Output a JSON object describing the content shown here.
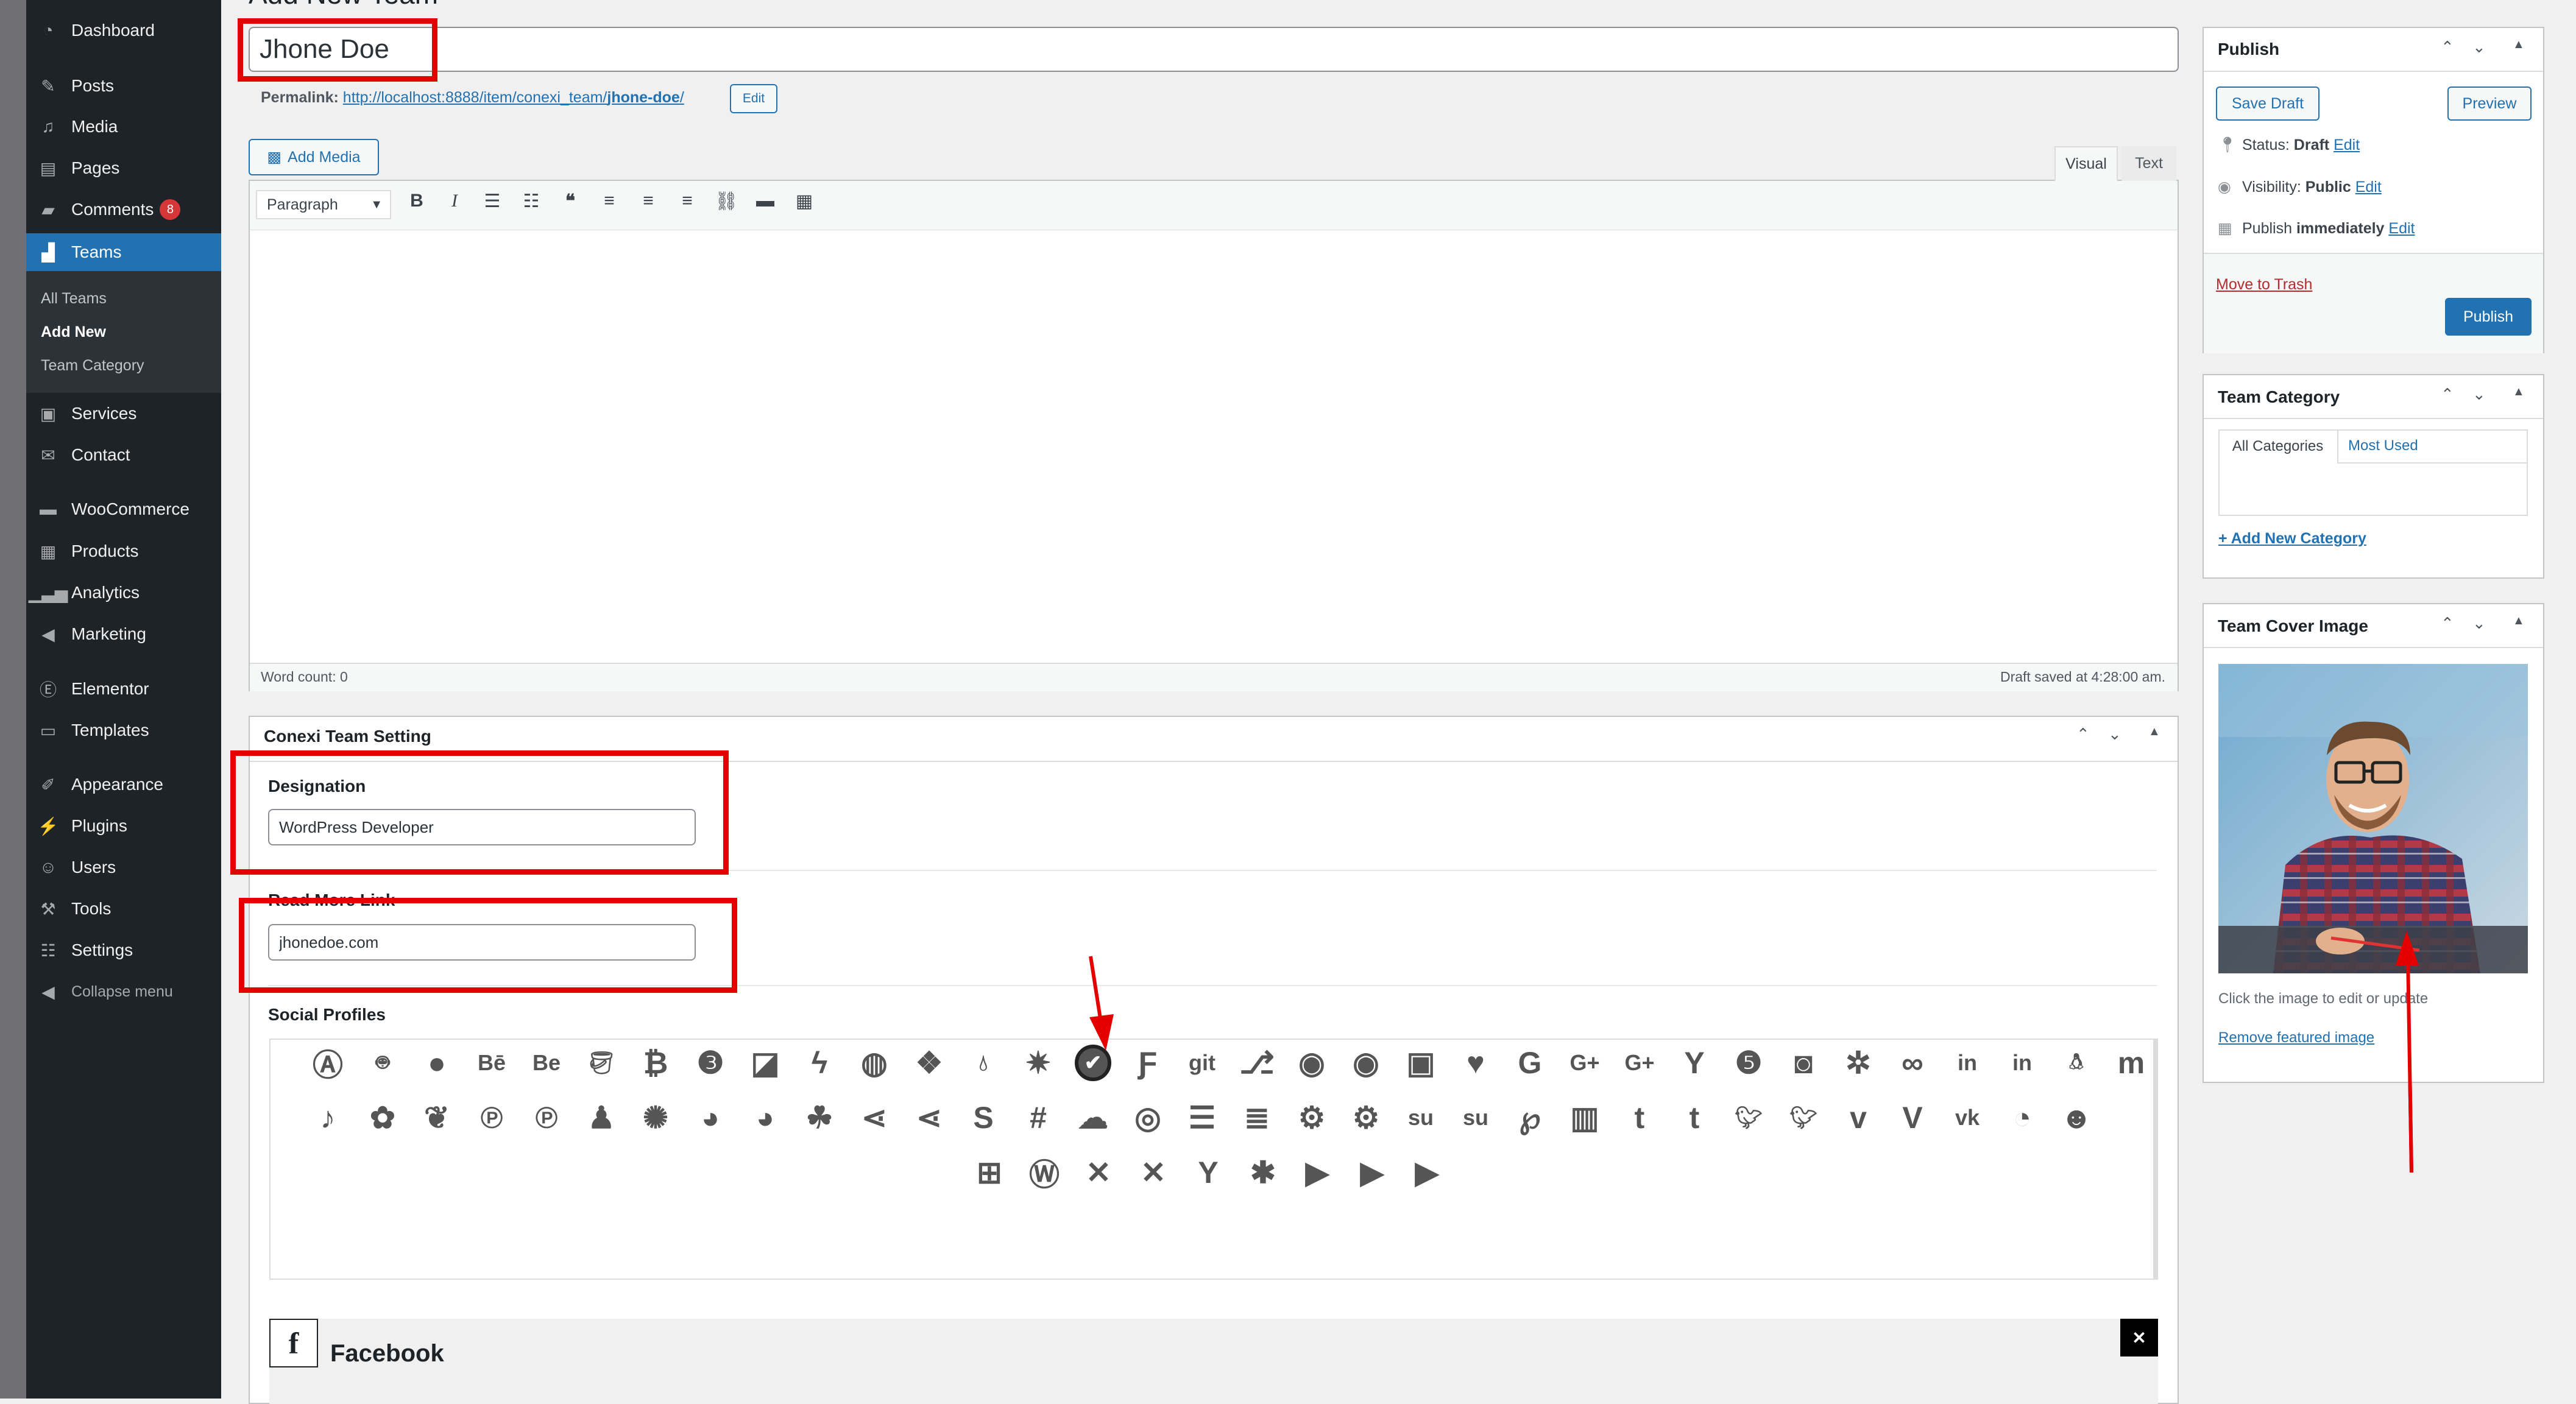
{
  "colors": {
    "menu_bg": "#1d2327",
    "accent": "#2271b1",
    "highlight": "#e50000",
    "badge": "#d63638"
  },
  "menu": {
    "dashboard": "Dashboard",
    "posts": "Posts",
    "media": "Media",
    "pages": "Pages",
    "comments": "Comments",
    "comments_badge": "8",
    "teams": "Teams",
    "teams_sub": {
      "all": "All Teams",
      "add_new": "Add New",
      "category": "Team Category"
    },
    "services": "Services",
    "contact": "Contact",
    "woocommerce": "WooCommerce",
    "products": "Products",
    "analytics": "Analytics",
    "marketing": "Marketing",
    "elementor": "Elementor",
    "templates": "Templates",
    "appearance": "Appearance",
    "plugins": "Plugins",
    "users": "Users",
    "tools": "Tools",
    "settings": "Settings",
    "collapse": "Collapse menu"
  },
  "page": {
    "title": "Add New Team"
  },
  "post": {
    "title_value": "Jhone Doe",
    "permalink_label": "Permalink:",
    "permalink_base": "http://localhost:8888/item/conexi_team/",
    "permalink_slug": "jhone-doe",
    "permalink_end": "/",
    "edit_btn": "Edit"
  },
  "editor": {
    "add_media": "Add Media",
    "tab_visual": "Visual",
    "tab_text": "Text",
    "format": "Paragraph",
    "word_count": "Word count: 0",
    "draft_saved": "Draft saved at 4:28:00 am."
  },
  "team_setting": {
    "title": "Conexi Team Setting",
    "designation_label": "Designation",
    "designation_value": "WordPress Developer",
    "readmore_label": "Read More Link",
    "readmore_value": "jhonedoe.com",
    "social_label": "Social Profiles",
    "selected_profile": "Facebook"
  },
  "publish": {
    "title": "Publish",
    "save_draft": "Save Draft",
    "preview": "Preview",
    "status_label": "Status:",
    "status_value": "Draft",
    "edit": "Edit",
    "visibility_label": "Visibility:",
    "visibility_value": "Public",
    "publish_label": "Publish",
    "publish_value": "immediately",
    "trash": "Move to Trash",
    "publish_btn": "Publish"
  },
  "category": {
    "title": "Team Category",
    "tab_all": "All Categories",
    "tab_most": "Most Used",
    "add_new": "+ Add New Category"
  },
  "cover": {
    "title": "Team Cover Image",
    "hint": "Click the image to edit or update",
    "remove": "Remove featured image"
  },
  "social_icons_row1": [
    "app-store",
    "android",
    "apple",
    "behance",
    "behance-square",
    "bitbucket",
    "bitcoin",
    "css3",
    "delicious",
    "deviantart",
    "dribbble",
    "dropbox",
    "drupal",
    "empire",
    "check-circle",
    "foursquare",
    "git-square",
    "git",
    "github",
    "github-alt",
    "github-square",
    "gratipay",
    "google",
    "google-plus",
    "google-plus-square",
    "hacker-news",
    "html5",
    "instagram",
    "joomla",
    "lastfm",
    "linkedin",
    "linkedin-square",
    "linux",
    "maxcdn"
  ],
  "social_icons_row2": [
    "tiktok",
    "leaf",
    "pagelines",
    "pinterest",
    "pinterest-square",
    "qq",
    "rebel",
    "reddit",
    "reddit-square",
    "renren",
    "share-alt",
    "share-alt-square",
    "skype",
    "slack",
    "soundcloud",
    "spotify",
    "stack-exchange",
    "stack-overflow",
    "steam",
    "steam-square",
    "stumbleupon",
    "stumbleupon-circle",
    "tencent-weibo",
    "trello",
    "tumblr",
    "tumblr-square",
    "twitter",
    "twitter-square",
    "vimeo-square",
    "vine",
    "vk",
    "weibo",
    "weixin"
  ],
  "social_icons_row3": [
    "windows",
    "wordpress",
    "xing",
    "xing-square",
    "y-combinator",
    "yelp",
    "youtube",
    "youtube-play",
    "youtube-square"
  ]
}
